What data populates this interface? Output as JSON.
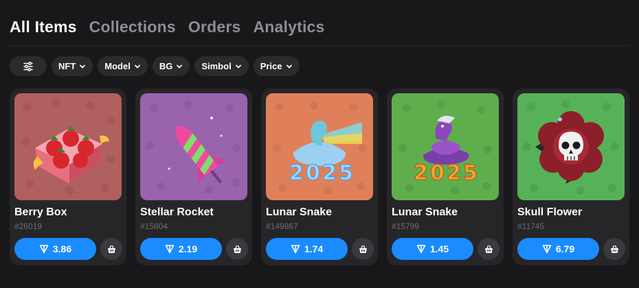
{
  "tabs": [
    {
      "label": "All Items",
      "active": true
    },
    {
      "label": "Collections",
      "active": false
    },
    {
      "label": "Orders",
      "active": false
    },
    {
      "label": "Analytics",
      "active": false
    }
  ],
  "filters": {
    "settings_icon": "sliders-icon",
    "chips": [
      "NFT",
      "Model",
      "BG",
      "Simbol",
      "Price"
    ]
  },
  "items": [
    {
      "name": "Berry Box",
      "id": "#26019",
      "price": "3.86",
      "bg": "#b0605e"
    },
    {
      "name": "Stellar Rocket",
      "id": "#15804",
      "price": "2.19",
      "bg": "#9a63ad"
    },
    {
      "name": "Lunar Snake",
      "id": "#149867",
      "price": "1.74",
      "bg": "#e0805a"
    },
    {
      "name": "Lunar Snake",
      "id": "#15799",
      "price": "1.45",
      "bg": "#5fae4e"
    },
    {
      "name": "Skull Flower",
      "id": "#11745",
      "price": "6.79",
      "bg": "#56b258"
    }
  ],
  "colors": {
    "accent": "#1a8cff",
    "background": "#18181a",
    "card": "#262629"
  }
}
